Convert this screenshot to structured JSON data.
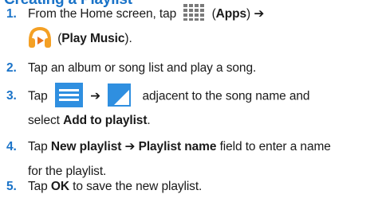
{
  "heading": "Creating a Playlist",
  "steps": [
    {
      "number": "1.",
      "line1_a": "From the Home screen, tap",
      "apps_open": "(",
      "apps_label": "Apps",
      "apps_close": ")",
      "arrow": "➔",
      "music_open": "(",
      "music_label": "Play Music",
      "music_close": ")."
    },
    {
      "number": "2.",
      "text": "Tap an album or song list and play a song."
    },
    {
      "number": "3.",
      "tap": "Tap",
      "arrow": "➔",
      "line1_tail": "adjacent to the song name and",
      "line2_a": "select ",
      "line2_bold": "Add to playlist",
      "line2_end": "."
    },
    {
      "number": "4.",
      "tap": "Tap ",
      "bold_a": "New playlist ➔ Playlist name",
      "line1_tail": " field to enter a name",
      "line2": "for the playlist."
    },
    {
      "number": "5.",
      "tap": "Tap ",
      "bold_ok": "OK",
      "tail": " to save the new playlist."
    }
  ],
  "icons": {
    "apps": "apps-grid-icon",
    "music": "play-music-headphones-icon",
    "menu": "menu-lines-icon",
    "overflow": "overflow-corner-icon"
  },
  "colors": {
    "accent": "#1a73c8",
    "icon_bg": "#2f8fe0",
    "music_orange": "#f4a024"
  }
}
